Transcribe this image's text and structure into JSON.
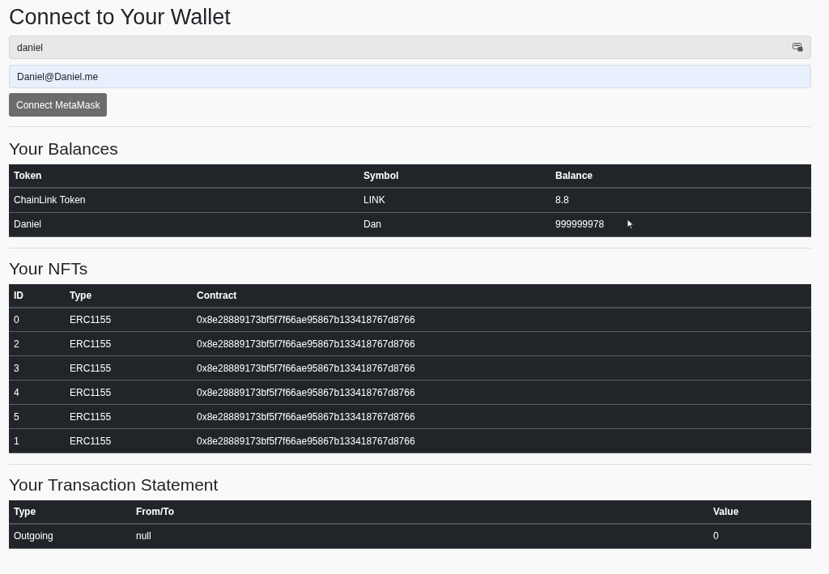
{
  "title": "Connect to Your Wallet",
  "form": {
    "name_field": {
      "value": "daniel"
    },
    "email_field": {
      "value": "Daniel@Daniel.me"
    },
    "connect_button": "Connect MetaMask"
  },
  "balances": {
    "heading": "Your Balances",
    "columns": [
      "Token",
      "Symbol",
      "Balance"
    ],
    "rows": [
      [
        "ChainLink Token",
        "LINK",
        "8.8"
      ],
      [
        "Daniel",
        "Dan",
        "999999978"
      ]
    ]
  },
  "nfts": {
    "heading": "Your NFTs",
    "columns": [
      "ID",
      "Type",
      "Contract"
    ],
    "rows": [
      [
        "0",
        "ERC1155",
        "0x8e28889173bf5f7f66ae95867b133418767d8766"
      ],
      [
        "2",
        "ERC1155",
        "0x8e28889173bf5f7f66ae95867b133418767d8766"
      ],
      [
        "3",
        "ERC1155",
        "0x8e28889173bf5f7f66ae95867b133418767d8766"
      ],
      [
        "4",
        "ERC1155",
        "0x8e28889173bf5f7f66ae95867b133418767d8766"
      ],
      [
        "5",
        "ERC1155",
        "0x8e28889173bf5f7f66ae95867b133418767d8766"
      ],
      [
        "1",
        "ERC1155",
        "0x8e28889173bf5f7f66ae95867b133418767d8766"
      ]
    ]
  },
  "transactions": {
    "heading": "Your Transaction Statement",
    "columns": [
      "Type",
      "From/To",
      "Value"
    ],
    "rows": [
      [
        "Outgoing",
        "null",
        "0"
      ]
    ]
  }
}
